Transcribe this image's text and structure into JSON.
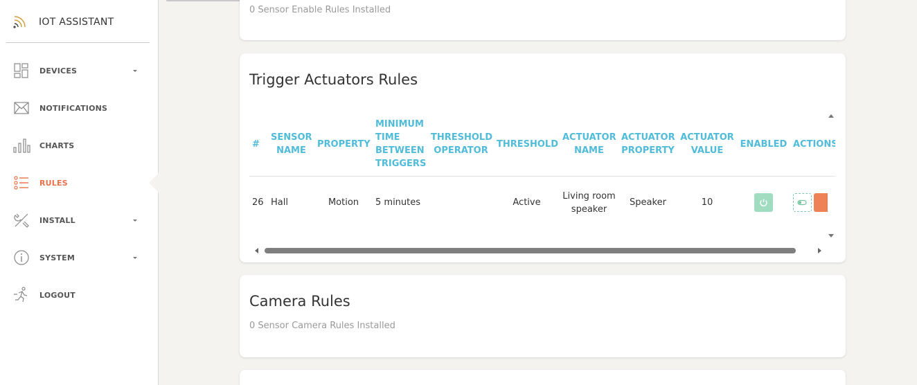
{
  "brand": {
    "name": "IOT ASSISTANT"
  },
  "sidebar": {
    "items": [
      {
        "label": "DEVICES",
        "icon": "dashboard-icon",
        "has_caret": true
      },
      {
        "label": "NOTIFICATIONS",
        "icon": "envelope-icon",
        "has_caret": false
      },
      {
        "label": "CHARTS",
        "icon": "bar-chart-icon",
        "has_caret": false
      },
      {
        "label": "RULES",
        "icon": "list-icon",
        "has_caret": false,
        "active": true
      },
      {
        "label": "INSTALL",
        "icon": "tools-icon",
        "has_caret": true
      },
      {
        "label": "SYSTEM",
        "icon": "info-icon",
        "has_caret": true
      },
      {
        "label": "LOGOUT",
        "icon": "running-person-icon",
        "has_caret": false
      }
    ]
  },
  "sensor_enable_card": {
    "subtitle": "0 Sensor Enable Rules Installed"
  },
  "trigger_card": {
    "title": "Trigger Actuators Rules",
    "columns": [
      "#",
      "SENSOR NAME",
      "PROPERTY",
      "MINIMUM TIME BETWEEN TRIGGERS",
      "THRESHOLD OPERATOR",
      "THRESHOLD",
      "ACTUATOR NAME",
      "ACTUATOR PROPERTY",
      "ACTUATOR VALUE",
      "ENABLED",
      "ACTIONS"
    ],
    "rows": [
      {
        "id": "26",
        "sensor_name": "Hall",
        "property": "Motion",
        "min_time": "5 minutes",
        "threshold_operator": "",
        "threshold": "Active",
        "actuator_name": "Living room speaker",
        "actuator_property": "Speaker",
        "actuator_value": "10"
      }
    ]
  },
  "camera_card": {
    "title": "Camera Rules",
    "subtitle": "0 Sensor Camera Rules Installed"
  },
  "colors": {
    "accent": "#e9714a",
    "header_text": "#51bcda",
    "enabled_button": "#9fdcc0",
    "delete_button": "#ef8157"
  }
}
